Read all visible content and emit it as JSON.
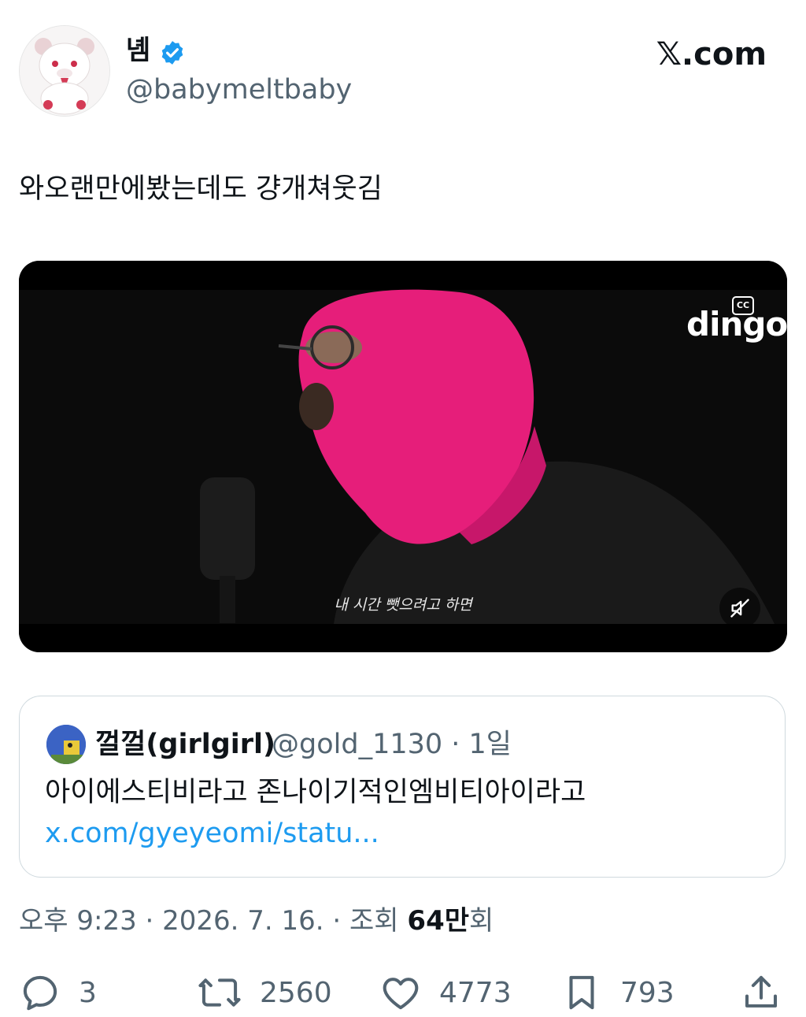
{
  "author": {
    "display_name": "녬",
    "handle": "@babymeltbaby"
  },
  "brand": "𝕏.com",
  "tweet_text": "와오랜만에봤는데도 걍개쳐웃김",
  "video": {
    "cc_label": "CC",
    "logo": "dingo",
    "subtitle": "내 시간 뺏으려고 하면"
  },
  "quote": {
    "name": "껄껄(girlgirl)",
    "handle_time": "@gold_1130 · 1일",
    "text": "아이에스티비라고 존나이기적인엠비티아이라고 ",
    "link": "x.com/gyeyeomi/statu..."
  },
  "meta": {
    "time": "오후 9:23 · 2026. 7. 16. · 조회 ",
    "views": "64만",
    "views_suffix": "회"
  },
  "actions": {
    "replies": "3",
    "reposts": "2560",
    "likes": "4773",
    "bookmarks": "793"
  },
  "colors": {
    "accent": "#1d9bf0",
    "muted": "#536471",
    "mask": "#e61e7a"
  }
}
